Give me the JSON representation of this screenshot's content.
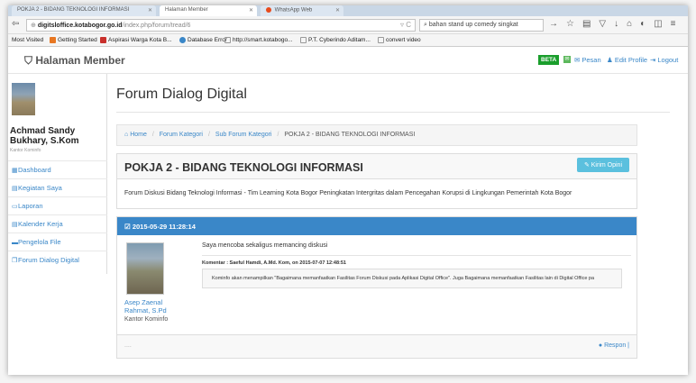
{
  "browser": {
    "tabs": [
      {
        "label": "POKJA 2 - BIDANG TEKNOLOGI INFORMASI"
      },
      {
        "label": "Halaman Member"
      },
      {
        "label": "WhatsApp Web"
      }
    ],
    "url_host": "digitsloffice.kotabogor.go.id",
    "url_path": "/index.php/forum/tread/6",
    "search_value": "bahan stand up comedy singkat",
    "bookmarks": [
      "Most Visited",
      "Getting Started",
      "Aspirasi Warga Kota B...",
      "Database Error",
      "http://smart.kotabogo...",
      "P.T. Cyberindo Aditam...",
      "convert video"
    ]
  },
  "header": {
    "brand": "Halaman Member",
    "beta": "BETA",
    "pesan": "Pesan",
    "edit_profile": "Edit Profile",
    "logout": "Logout"
  },
  "sidebar": {
    "user_name": "Achmad Sandy Bukhary, S.Kom",
    "user_role": "Kantor Kominfo",
    "items": [
      {
        "label": "Dashboard"
      },
      {
        "label": "Kegiatan Saya"
      },
      {
        "label": "Laporan"
      },
      {
        "label": "Kalender Kerja"
      },
      {
        "label": "Pengelola File"
      },
      {
        "label": "Forum Dialog Digital"
      }
    ]
  },
  "main": {
    "page_title": "Forum Dialog Digital",
    "breadcrumb": [
      "Home",
      "Forum Kategori",
      "Sub Forum Kategori",
      "POKJA 2 - BIDANG TEKNOLOGI INFORMASI"
    ],
    "forum_title": "POKJA 2 - BIDANG TEKNOLOGI INFORMASI",
    "kirim_opini": "Kirim Opini",
    "forum_desc": "Forum Diskusi Bidang Teknologi Informasi - Tim Learning Kota Bogor Peningkatan Intergritas dalam Pencegahan Korupsi di Lingkungan Pemerintah Kota Bogor",
    "post": {
      "timestamp": "2015-05-29 11:28:14",
      "author_line1": "Asep Zaenal",
      "author_line2": "Rahmat, S.Pd",
      "office": "Kantor Kominfo",
      "message": "Saya mencoba sekaligus memancing diskusi",
      "comment_header": "Komentar : Saeful Hamdi, A.Md. Kom, on 2015-07-07 12:48:51",
      "comment_text": "Kominfo akan menampilkan \"Bagaimana memanfaatkan Fasilitas Forum Diskusi pada Aplikasi Digital Office\". Juga Bagaimana memanfaatkan Fasilitas lain di Digital Office pa",
      "dots": "....",
      "respon": "Respon |"
    }
  },
  "colors": {
    "accent": "#3a87c8",
    "beta": "#1a9e2c",
    "kirim_button": "#5bc0de"
  }
}
